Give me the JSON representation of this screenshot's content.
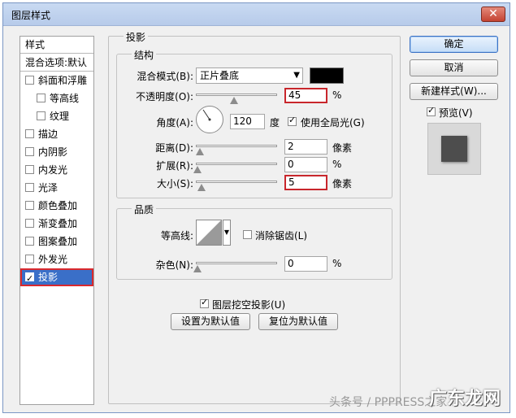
{
  "window": {
    "title": "图层样式",
    "close_glyph": "✕"
  },
  "styles": {
    "header": "样式",
    "blend_options": "混合选项:默认",
    "items": [
      {
        "label": "斜面和浮雕",
        "checked": false
      },
      {
        "label": "等高线",
        "checked": false
      },
      {
        "label": "纹理",
        "checked": false
      },
      {
        "label": "描边",
        "checked": false
      },
      {
        "label": "内阴影",
        "checked": false
      },
      {
        "label": "内发光",
        "checked": false
      },
      {
        "label": "光泽",
        "checked": false
      },
      {
        "label": "颜色叠加",
        "checked": false
      },
      {
        "label": "渐变叠加",
        "checked": false
      },
      {
        "label": "图案叠加",
        "checked": false
      },
      {
        "label": "外发光",
        "checked": false
      },
      {
        "label": "投影",
        "checked": true
      }
    ]
  },
  "drop_shadow": {
    "title": "投影",
    "structure": {
      "title": "结构",
      "blend_mode_label": "混合模式(B):",
      "blend_mode_value": "正片叠底",
      "shadow_color": "#000000",
      "opacity_label": "不透明度(O):",
      "opacity_value": "45",
      "opacity_unit": "%",
      "angle_label": "角度(A):",
      "angle_value": "120",
      "angle_unit": "度",
      "global_light_label": "使用全局光(G)",
      "global_light_checked": true,
      "distance_label": "距离(D):",
      "distance_value": "2",
      "distance_unit": "像素",
      "spread_label": "扩展(R):",
      "spread_value": "0",
      "spread_unit": "%",
      "size_label": "大小(S):",
      "size_value": "5",
      "size_unit": "像素"
    },
    "quality": {
      "title": "品质",
      "contour_label": "等高线:",
      "antialias_label": "消除锯齿(L)",
      "antialias_checked": false,
      "noise_label": "杂色(N):",
      "noise_value": "0",
      "noise_unit": "%"
    },
    "knockout_label": "图层挖空投影(U)",
    "knockout_checked": true,
    "set_default_label": "设置为默认值",
    "reset_default_label": "复位为默认值"
  },
  "buttons": {
    "ok": "确定",
    "cancel": "取消",
    "new_style": "新建样式(W)...",
    "preview_label": "预览(V)",
    "preview_checked": true
  },
  "watermark": {
    "left": "头条号 / PPPRESS之家",
    "logo": "广东龙网"
  },
  "colors": {
    "selection": "#3a6fc8",
    "highlight_border": "#c8262c",
    "titlebar": "#c9daf2"
  }
}
